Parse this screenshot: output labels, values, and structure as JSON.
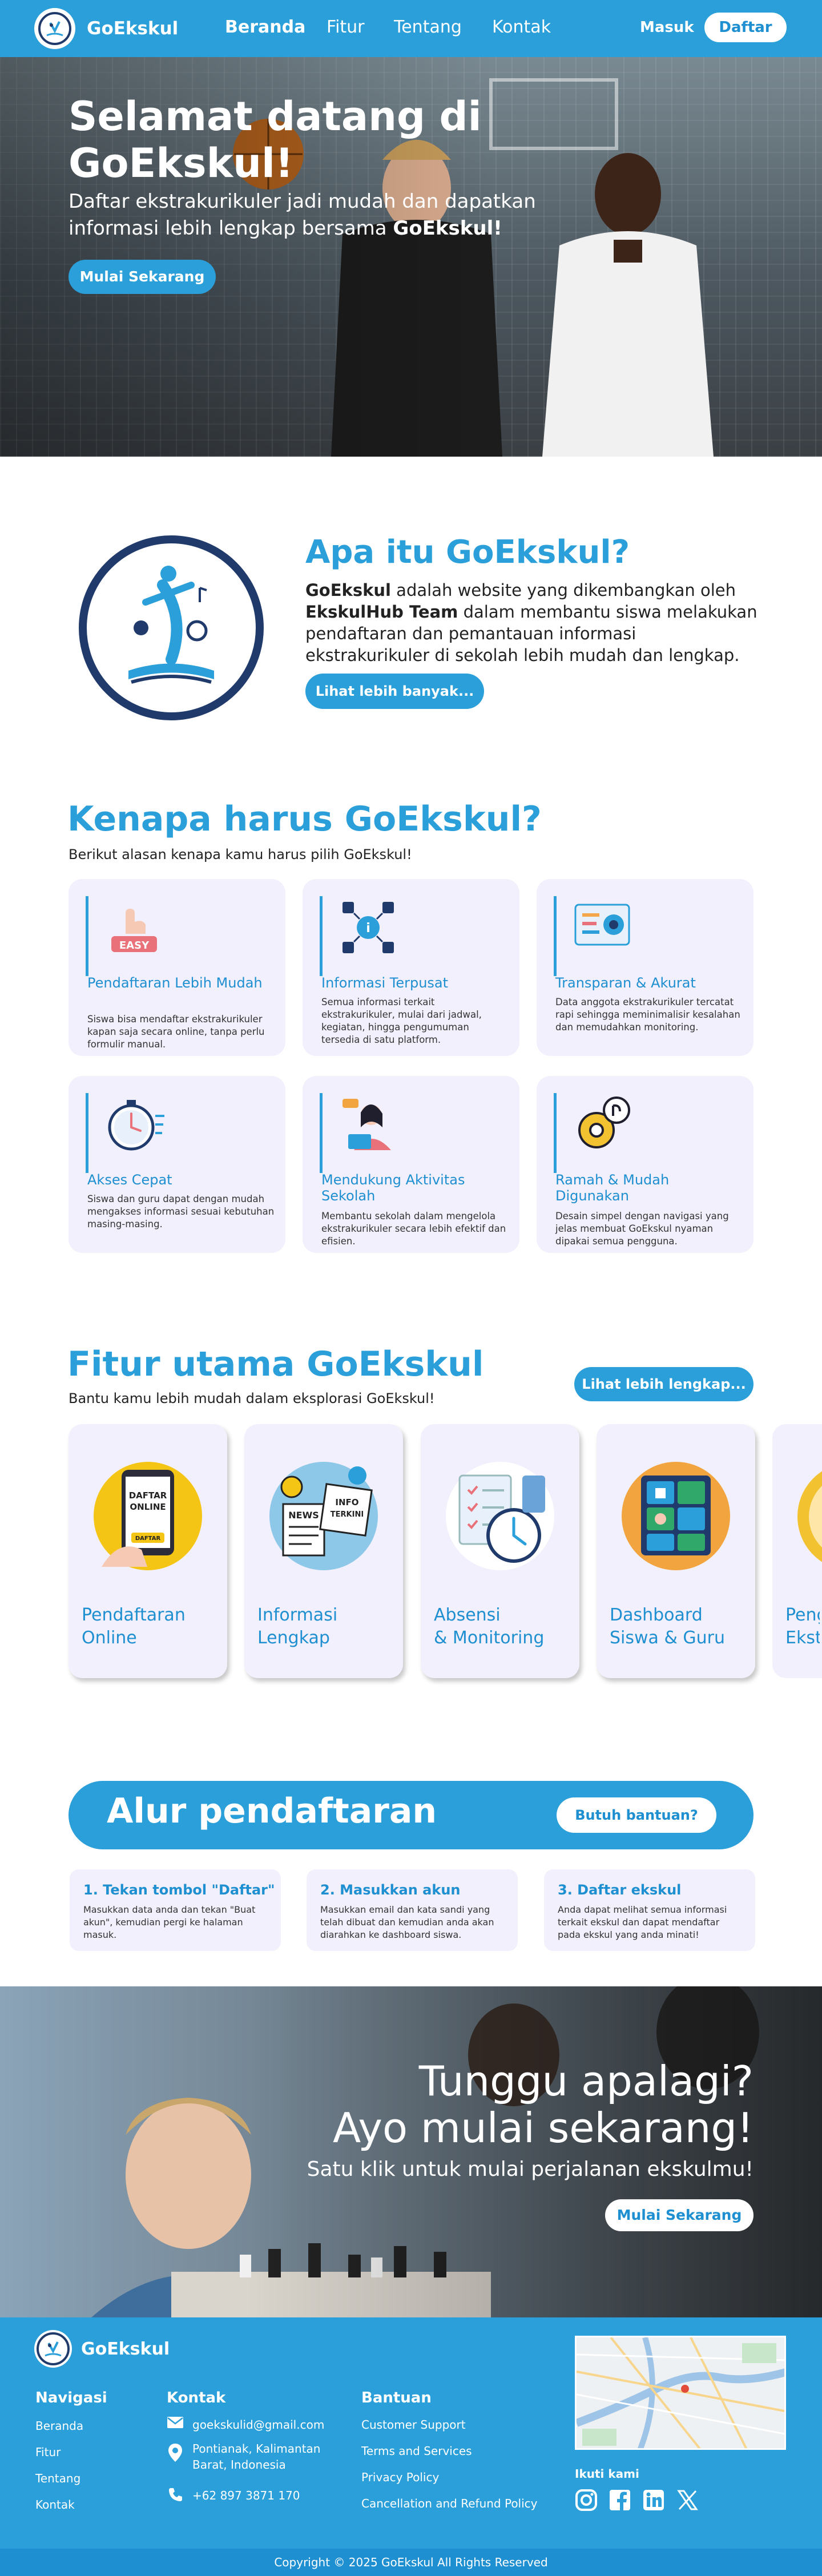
{
  "nav": {
    "brand": "GoEkskul",
    "links": [
      "Beranda",
      "Fitur",
      "Tentang",
      "Kontak"
    ],
    "login": "Masuk",
    "register": "Daftar"
  },
  "hero": {
    "title": "Selamat datang di GoEkskul!",
    "subtitle_pre": "Daftar ekstrakurikuler jadi mudah dan dapatkan informasi lebih lengkap bersama ",
    "subtitle_bold": "GoEkskul!",
    "button": "Mulai Sekarang"
  },
  "about": {
    "title": "Apa itu GoEkskul?",
    "bold1": "GoEkskul",
    "text1": " adalah website yang dikembangkan oleh ",
    "bold2": "EkskulHub Team",
    "text2": " dalam membantu siswa melakukan pendaftaran dan pemantauan informasi ekstrakurikuler di sekolah lebih mudah dan lengkap.",
    "button": "Lihat lebih banyak..."
  },
  "why": {
    "title": "Kenapa harus GoEkskul?",
    "subtitle": "Berikut alasan kenapa kamu harus pilih GoEkskul!",
    "cards": [
      {
        "title": "Pendaftaran Lebih Mudah",
        "desc": "Siswa bisa mendaftar ekstrakurikuler kapan saja secara online, tanpa perlu formulir manual.",
        "icon": "easy-hand-icon",
        "icon_text": "EASY"
      },
      {
        "title": "Informasi Terpusat",
        "desc": "Semua informasi terkait ekstrakurikuler, mulai dari jadwal, kegiatan, hingga pengumuman tersedia di satu platform.",
        "icon": "network-info-icon"
      },
      {
        "title": "Transparan & Akurat",
        "desc": "Data anggota ekstrakurikuler tercatat rapi sehingga meminimalisir kesalahan dan memudahkan monitoring.",
        "icon": "monitor-data-icon"
      },
      {
        "title": "Akses Cepat",
        "desc": "Siswa dan guru dapat dengan mudah mengakses informasi sesuai kebutuhan masing-masing.",
        "icon": "stopwatch-icon"
      },
      {
        "title": "Mendukung Aktivitas Sekolah",
        "desc": "Membantu sekolah dalam mengelola ekstrakurikuler secara lebih efektif dan efisien.",
        "icon": "person-laptop-icon"
      },
      {
        "title": "Ramah & Mudah Digunakan",
        "desc": "Desain simpel dengan navigasi yang jelas membuat GoEkskul nyaman dipakai semua pengguna.",
        "icon": "gear-hand-icon"
      }
    ]
  },
  "features": {
    "title": "Fitur utama GoEkskul",
    "subtitle": "Bantu kamu lebih mudah dalam eksplorasi GoEkskul!",
    "button": "Lihat lebih lengkap...",
    "cards": [
      {
        "line1": "Pendaftaran",
        "line2": "Online",
        "icon": "online-register-icon",
        "art_text1": "DAFTAR",
        "art_text2": "ONLINE",
        "art_text3": "DAFTAR"
      },
      {
        "line1": "Informasi",
        "line2": "Lengkap",
        "icon": "news-info-icon",
        "art_text1": "NEWS",
        "art_text2": "INFO",
        "art_text3": "TERKINI"
      },
      {
        "line1": "Absensi",
        "line2": "& Monitoring",
        "icon": "attendance-icon"
      },
      {
        "line1": "Dashboard",
        "line2": "Siswa & Guru",
        "icon": "dashboard-icon"
      },
      {
        "line1": "Peng",
        "line2": "Ekst",
        "icon": "partial-feature-icon"
      }
    ]
  },
  "flow": {
    "title": "Alur pendaftaran",
    "button": "Butuh bantuan?",
    "steps": [
      {
        "title": "1. Tekan tombol \"Daftar\"",
        "desc": "Masukkan data anda dan tekan \"Buat akun\", kemudian pergi ke halaman masuk."
      },
      {
        "title": "2. Masukkan akun",
        "desc": "Masukkan email dan kata sandi yang telah dibuat dan kemudian anda akan diarahkan ke dashboard siswa."
      },
      {
        "title": "3. Daftar ekskul",
        "desc": "Anda dapat melihat semua informasi terkait ekskul dan dapat mendaftar pada ekskul yang anda minati!"
      }
    ]
  },
  "cta": {
    "line1": "Tunggu apalagi?",
    "line2": "Ayo mulai sekarang!",
    "subtitle": "Satu klik untuk mulai perjalanan ekskulmu!",
    "button": "Mulai Sekarang"
  },
  "footer": {
    "brand": "GoEkskul",
    "nav_title": "Navigasi",
    "nav_links": [
      "Beranda",
      "Fitur",
      "Tentang",
      "Kontak"
    ],
    "contact_title": "Kontak",
    "email": "goekskulid@gmail.com",
    "address_line1": "Pontianak, Kalimantan",
    "address_line2": "Barat, Indonesia",
    "phone": "+62 897 3871 170",
    "help_title": "Bantuan",
    "help_links": [
      "Customer Support",
      "Terms and Services",
      "Privacy Policy",
      "Cancellation and Refund Policy"
    ],
    "follow": "Ikuti kami",
    "social": [
      "instagram-icon",
      "facebook-icon",
      "linkedin-icon",
      "x-icon"
    ],
    "copyright": "Copyright © 2025 GoEkskul All Rights Reserved"
  },
  "colors": {
    "primary": "#2a9fd9",
    "card_bg": "#f2f0fd",
    "dark_navy": "#1f3a6b"
  }
}
